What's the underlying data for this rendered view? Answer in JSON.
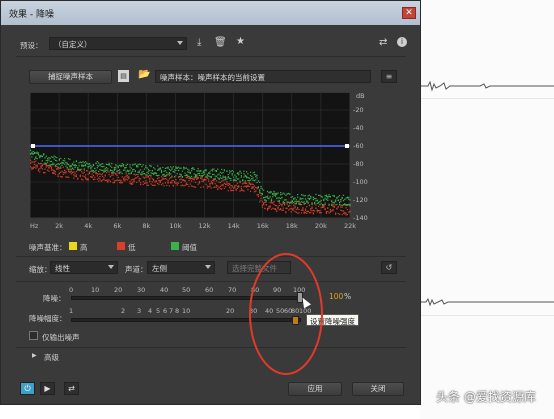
{
  "window": {
    "title": "效果 - 降噪",
    "close_icon": "close-icon"
  },
  "preset": {
    "label": "预设：",
    "value": "（自定义）"
  },
  "capture_button": "捕捉噪声样本",
  "noise_sample": {
    "value": "噪声样本：噪声样本的当前设置"
  },
  "graph": {
    "y_unit": "dB",
    "y_labels": [
      "-20",
      "-40",
      "-60",
      "-80",
      "-100",
      "-120",
      "-140"
    ],
    "x_labels": [
      "Hz",
      "2k",
      "4k",
      "6k",
      "8k",
      "10k",
      "12k",
      "14k",
      "16k",
      "18k",
      "20k",
      "22k"
    ]
  },
  "chart_data": {
    "type": "line",
    "title": "",
    "xlabel": "Hz",
    "ylabel": "dB",
    "xlim": [
      0,
      22000
    ],
    "ylim": [
      -140,
      0
    ],
    "x_ticks": [
      "Hz",
      "2k",
      "4k",
      "6k",
      "8k",
      "10k",
      "12k",
      "14k",
      "16k",
      "18k",
      "20k",
      "22k"
    ],
    "y_ticks": [
      -20,
      -40,
      -60,
      -80,
      -100,
      -120,
      -140
    ],
    "grid": true,
    "legend": "bottom-left",
    "series": [
      {
        "name": "高",
        "color": "#e8d81c",
        "x": [
          0,
          22000
        ],
        "values": [
          -60,
          -60
        ]
      },
      {
        "name": "低",
        "color": "#d8402a",
        "x": [
          0,
          1000,
          2000,
          4000,
          6000,
          8000,
          10000,
          12000,
          14000,
          15500,
          16000,
          18000,
          22000
        ],
        "values": [
          -80,
          -84,
          -88,
          -92,
          -95,
          -97,
          -98,
          -100,
          -104,
          -106,
          -126,
          -128,
          -130
        ]
      },
      {
        "name": "阈值",
        "color": "#3bb14a",
        "x": [
          0,
          1000,
          2000,
          4000,
          6000,
          8000,
          10000,
          12000,
          14000,
          15500,
          16000,
          18000,
          22000
        ],
        "values": [
          -70,
          -74,
          -78,
          -82,
          -84,
          -86,
          -88,
          -90,
          -92,
          -94,
          -114,
          -118,
          -120
        ]
      }
    ],
    "threshold_line": {
      "color": "#4b6bff",
      "value": -60
    }
  },
  "legend": {
    "label": "噪声基准：",
    "items": [
      {
        "label": "高",
        "color": "#e8d81c"
      },
      {
        "label": "低",
        "color": "#d8402a"
      },
      {
        "label": "阈值",
        "color": "#3bb14a"
      }
    ]
  },
  "scale": {
    "label": "缩放：",
    "value": "线性"
  },
  "channel": {
    "label": "声道：",
    "value": "左侧"
  },
  "select_whole_file": "选择完整文件",
  "noise_reduction": {
    "label": "降噪：",
    "ticks": [
      "0",
      "10",
      "20",
      "30",
      "40",
      "50",
      "60",
      "70",
      "80",
      "90",
      "100"
    ],
    "value": "100",
    "unit": "%",
    "fraction": 1.0
  },
  "reduce_by": {
    "label": "降噪幅度：",
    "ticks": [
      "1",
      "2",
      "3",
      "4",
      "5",
      "6",
      "7",
      "8",
      "10",
      "20",
      "30",
      "40",
      "50",
      "60",
      "80",
      "100"
    ],
    "fraction": 0.98
  },
  "tooltip": "设置降噪强度",
  "output_noise_only": "仅输出噪声",
  "advanced": "高级",
  "buttons": {
    "apply": "应用",
    "close": "关闭"
  },
  "watermark": "头条 @爱找资源库"
}
